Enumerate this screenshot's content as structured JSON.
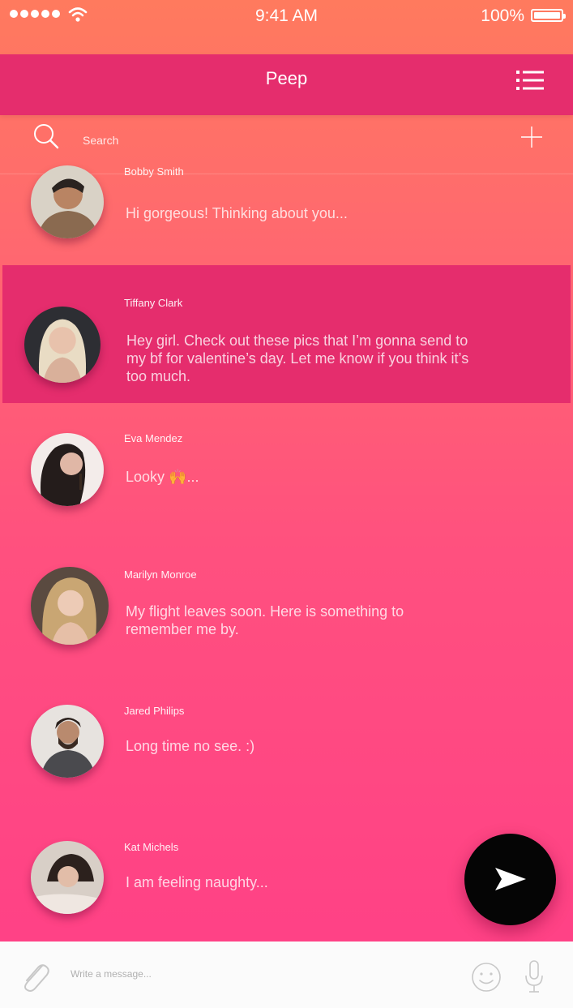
{
  "status_bar": {
    "time": "9:41 AM",
    "battery": "100%"
  },
  "nav": {
    "title": "Peep",
    "menu_icon": "list-menu-icon"
  },
  "search": {
    "placeholder": "Search",
    "add_icon": "plus-icon"
  },
  "conversations": [
    {
      "name": "Bobby Smith",
      "preview": "Hi gorgeous!  Thinking about you...",
      "active": false
    },
    {
      "name": "Tiffany Clark",
      "preview": "Hey girl.  Check out these pics that I’m gonna send to my bf for valentine’s day.  Let me know if you think it’s too much.",
      "active": true
    },
    {
      "name": "Eva Mendez",
      "preview": "Looky 🙌...",
      "active": false
    },
    {
      "name": "Marilyn Monroe",
      "preview": "My flight leaves soon.  Here is something to remember me by.",
      "active": false
    },
    {
      "name": "Jared Philips",
      "preview": "Long time no see. :)",
      "active": false
    },
    {
      "name": "Kat Michels",
      "preview": "I am feeling naughty...",
      "active": false
    }
  ],
  "composer": {
    "placeholder": "Write a message..."
  },
  "colors": {
    "nav": "#e52d6d",
    "active_row": "#e52d6d",
    "gradient_top": "#ff7a5e",
    "gradient_bottom": "#ff3f87",
    "fab": "#050505"
  }
}
